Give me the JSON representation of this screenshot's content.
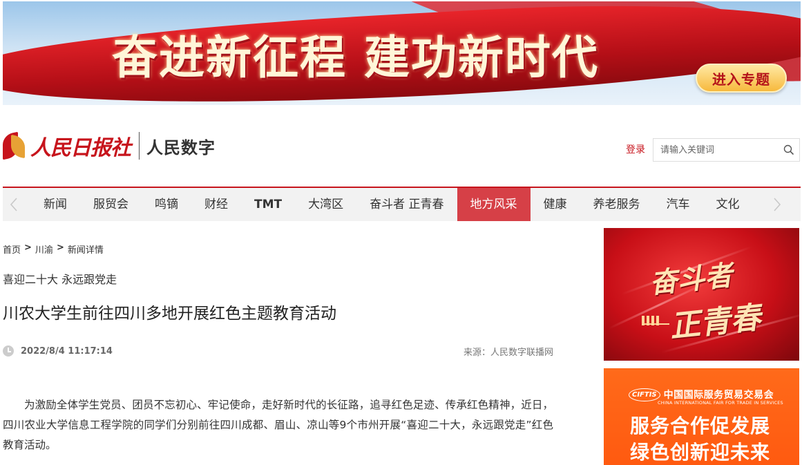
{
  "banner": {
    "slogan": "奋进新征程  建功新时代",
    "enter_button": "进入专题"
  },
  "header": {
    "logo_text": "人民日报社",
    "site_name": "人民数字",
    "login_label": "登录",
    "search": {
      "placeholder": "请输入关键词",
      "icon": "search-icon"
    }
  },
  "nav": {
    "items": [
      {
        "label": "新闻"
      },
      {
        "label": "服贸会"
      },
      {
        "label": "鸣镝"
      },
      {
        "label": "财经"
      },
      {
        "label": "TMT"
      },
      {
        "label": "大湾区"
      },
      {
        "label": "奋斗者 正青春"
      },
      {
        "label": "地方风采"
      },
      {
        "label": "健康"
      },
      {
        "label": "养老服务"
      },
      {
        "label": "汽车"
      },
      {
        "label": "文化"
      }
    ],
    "active_index": 7,
    "prev_icon": "chevron-left-icon",
    "next_icon": "chevron-right-icon"
  },
  "breadcrumb": {
    "items": [
      "首页",
      "川渝",
      "新闻详情"
    ],
    "separator": ">"
  },
  "article": {
    "kicker": "喜迎二十大 永远跟党走",
    "title": "川农大学生前往四川多地开展红色主题教育活动",
    "date": "2022/8/4 11:17:14",
    "source": "来源：人民数字联播网",
    "body": "为激励全体学生党员、团员不忘初心、牢记使命，走好新时代的长征路，追寻红色足迹、传承红色精神，近日，四川农业大学信息工程学院的同学们分别前往四川成都、眉山、凉山等9个市州开展“喜迎二十大，永远跟党走”红色教育活动。"
  },
  "sidebar": {
    "ad1": {
      "line1": "奋斗者",
      "line2": "正青春"
    },
    "ad2": {
      "brand_logo": "CIFTIS",
      "brand_cn": "中国国际服务贸易交易会",
      "brand_en": "CHINA INTERNATIONAL FAIR FOR TRADE IN SERVICES",
      "line1": "服务合作促发展",
      "line2": "绿色创新迎未来"
    }
  },
  "colors": {
    "accent": "#c7141c",
    "nav_active": "#d64047",
    "ad_orange": "#ff5a10"
  }
}
